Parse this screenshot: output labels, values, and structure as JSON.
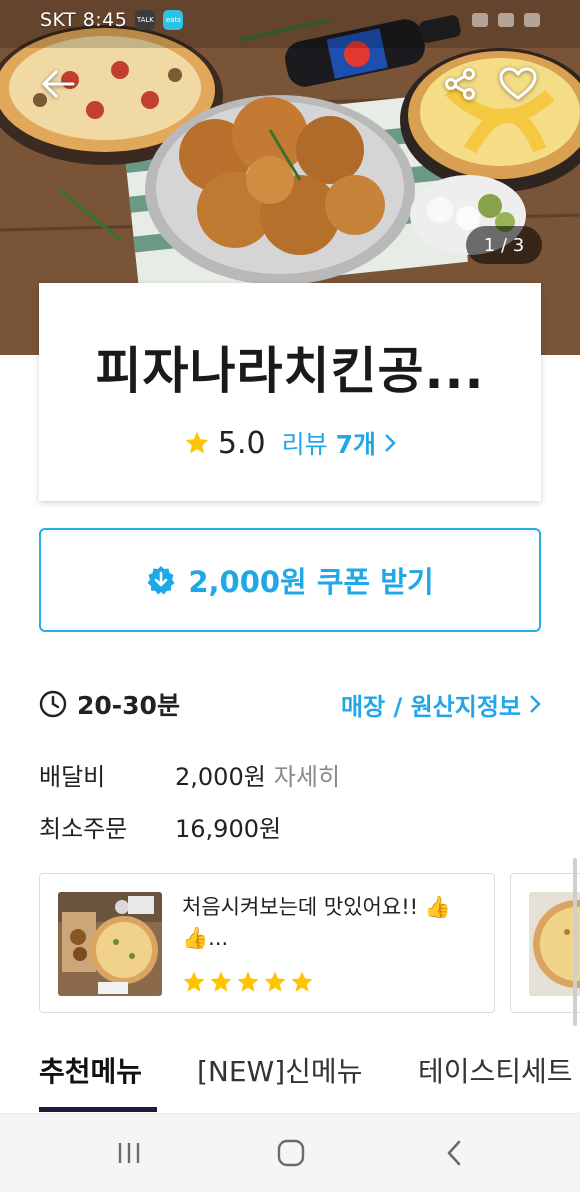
{
  "status_bar": {
    "carrier_time": "SKT 8:45",
    "app_icons": [
      "TALK",
      "eats"
    ]
  },
  "hero": {
    "image_counter": "1 / 3",
    "icons": [
      "back-arrow-icon",
      "share-icon",
      "heart-icon"
    ]
  },
  "store": {
    "name": "피자나라치킨공...",
    "rating": "5.0",
    "review_label": "리뷰",
    "review_count": "7개"
  },
  "coupon": {
    "label": "2,000원 쿠폰 받기"
  },
  "delivery": {
    "time": "20-30분",
    "origin_link": "매장 / 원산지정보"
  },
  "fees": {
    "delivery_fee_label": "배달비",
    "delivery_fee_value": "2,000원",
    "delivery_fee_detail": "자세히",
    "min_order_label": "최소주문",
    "min_order_value": "16,900원"
  },
  "reviews": [
    {
      "text": "처음시켜보는데  맛있어요!! 👍👍...",
      "stars": 5
    }
  ],
  "tabs": [
    {
      "label": "추천메뉴",
      "active": true
    },
    {
      "label": "[NEW]신메뉴",
      "active": false
    },
    {
      "label": "테이스티세트",
      "active": false
    }
  ],
  "colors": {
    "accent_blue": "#22a6e8",
    "star_yellow": "#ffc400",
    "tab_underline": "#1c1c3a"
  }
}
